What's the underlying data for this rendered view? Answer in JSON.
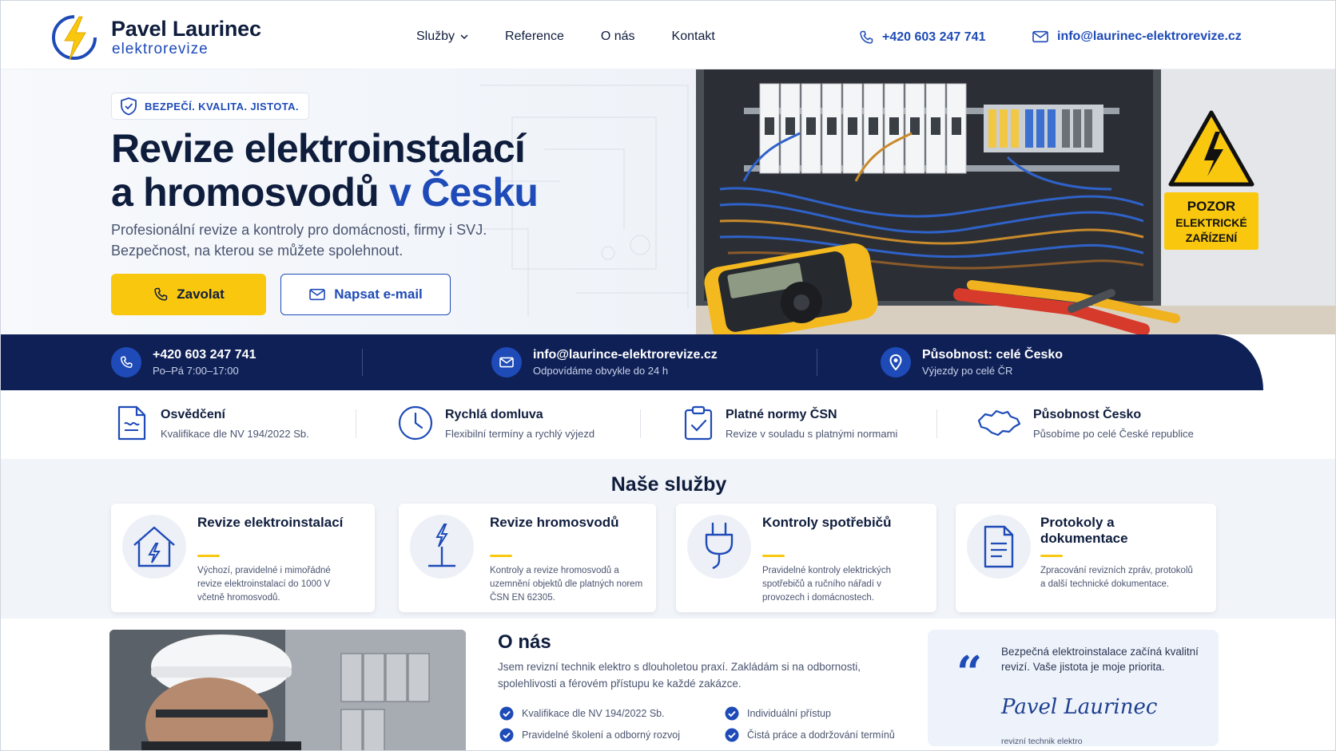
{
  "colors": {
    "navy": "#0f1d3d",
    "blue": "#1e4bb8",
    "yellow": "#f9c80e",
    "strip": "#0f2057"
  },
  "brand": {
    "name": "Pavel Laurinec",
    "subtitle": "elektrorevize",
    "icon": "lightning-bolt-icon"
  },
  "nav": {
    "items": [
      "Služby",
      "Reference",
      "O nás",
      "Kontakt"
    ]
  },
  "header_contact": {
    "phone": "+420 603 247 741",
    "email": "info@laurinec-elektrorevize.cz"
  },
  "hero": {
    "badge": "BEZPEČÍ. KVALITA. JISTOTA.",
    "title_line1": "Revize elektroinstalací",
    "title_line2_start": "a hromosvodů ",
    "title_line2_accent": "v Česku",
    "subtitle": "Profesionální revize a kontroly pro domácnosti, firmy i SVJ. Bezpečnost, na kterou se můžete spolehnout.",
    "btn_call": "Zavolat",
    "btn_mail": "Napsat e-mail",
    "warning_sign": "POZOR ELEKTRICKÉ ZAŘÍZENÍ"
  },
  "strip": [
    {
      "main": "+420 603 247 741",
      "sub": "Po–Pá 7:00–17:00",
      "icon": "phone-icon"
    },
    {
      "main": "info@laurince-elektrorevize.cz",
      "sub": "Odpovídáme obvykle do 24 h",
      "icon": "mail-icon"
    },
    {
      "main": "Působnost: celé Česko",
      "sub": "Výjezdy po celé ČR",
      "icon": "location-pin-icon"
    }
  ],
  "features": [
    {
      "title": "Osvědčení",
      "desc": "Kvalifikace dle NV 194/2022 Sb.",
      "icon": "certificate-icon"
    },
    {
      "title": "Rychlá domluva",
      "desc": "Flexibilní termíny a rychlý výjezd",
      "icon": "clock-icon"
    },
    {
      "title": "Platné normy ČSN",
      "desc": "Revize v souladu s platnými normami",
      "icon": "clipboard-check-icon"
    },
    {
      "title": "Působnost Česko",
      "desc": "Působíme po celé České republice",
      "icon": "czech-map-icon"
    }
  ],
  "services": {
    "title": "Naše služby",
    "cards": [
      {
        "title": "Revize elektroinstalací",
        "desc": "Výchozí, pravidelné i mimořádné revize elektroinstalací do 1000 V včetně hromosvodů.",
        "icon": "house-bolt-icon"
      },
      {
        "title": "Revize hromosvodů",
        "desc": "Kontroly a revize hromosvodů a uzemnění objektů dle platných norem ČSN EN 62305.",
        "icon": "lightning-rod-icon"
      },
      {
        "title": "Kontroly spotřebičů",
        "desc": "Pravidelné kontroly elektrických spotřebičů a ručního nářadí v provozech i domácnostech.",
        "icon": "plug-icon"
      },
      {
        "title": "Protokoly a dokumentace",
        "desc": "Zpracování revizních zpráv, protokolů a další technické dokumentace.",
        "icon": "document-icon"
      }
    ]
  },
  "about": {
    "title": "O nás",
    "text": "Jsem revizní technik elektro s dlouholetou praxí. Zakládám si na odbornosti, spolehlivosti a férovém přístupu ke každé zakázce.",
    "checks": [
      "Kvalifikace dle NV 194/2022 Sb.",
      "Pravidelné školení a odborný rozvoj",
      "Individuální přístup",
      "Čistá práce a dodržování termínů"
    ],
    "quote": "Bezpečná elektroinstalace začíná kvalitní revizí. Vaše jistota je moje priorita.",
    "signature": "Pavel Laurinec",
    "signature_role": "revizní technik elektro"
  }
}
